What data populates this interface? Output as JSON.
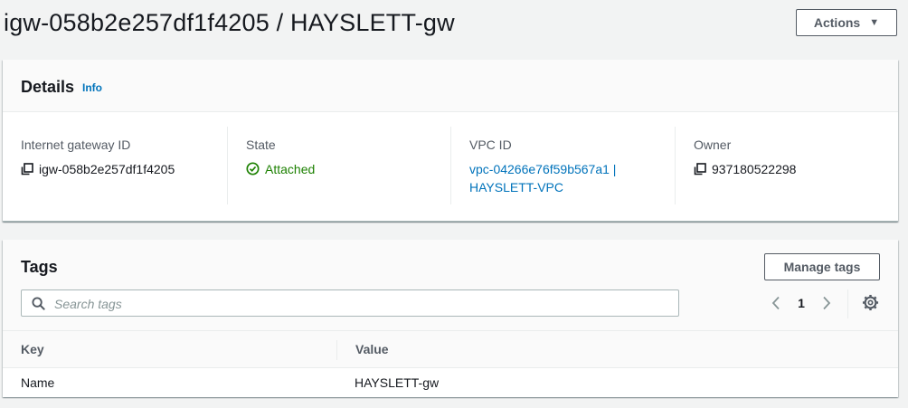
{
  "header": {
    "title": "igw-058b2e257df1f4205 / HAYSLETT-gw",
    "actions_label": "Actions"
  },
  "details": {
    "title": "Details",
    "info_label": "Info",
    "fields": {
      "igw": {
        "label": "Internet gateway ID",
        "value": "igw-058b2e257df1f4205"
      },
      "state": {
        "label": "State",
        "value": "Attached"
      },
      "vpc": {
        "label": "VPC ID",
        "value_line1": "vpc-04266e76f59b567a1 |",
        "value_line2": "HAYSLETT-VPC"
      },
      "owner": {
        "label": "Owner",
        "value": "937180522298"
      }
    }
  },
  "tags": {
    "title": "Tags",
    "manage_label": "Manage tags",
    "search_placeholder": "Search tags",
    "search_value": "",
    "page_number": "1",
    "columns": {
      "key": "Key",
      "value": "Value"
    },
    "rows": [
      {
        "key": "Name",
        "value": "HAYSLETT-gw"
      }
    ]
  },
  "colors": {
    "accent_link": "#0073bb",
    "status_success": "#1d8102",
    "background": "#f2f3f3"
  },
  "icons": [
    "copy-icon",
    "check-circle-icon",
    "search-icon",
    "chevron-left-icon",
    "chevron-right-icon",
    "gear-icon",
    "caret-down-icon"
  ]
}
